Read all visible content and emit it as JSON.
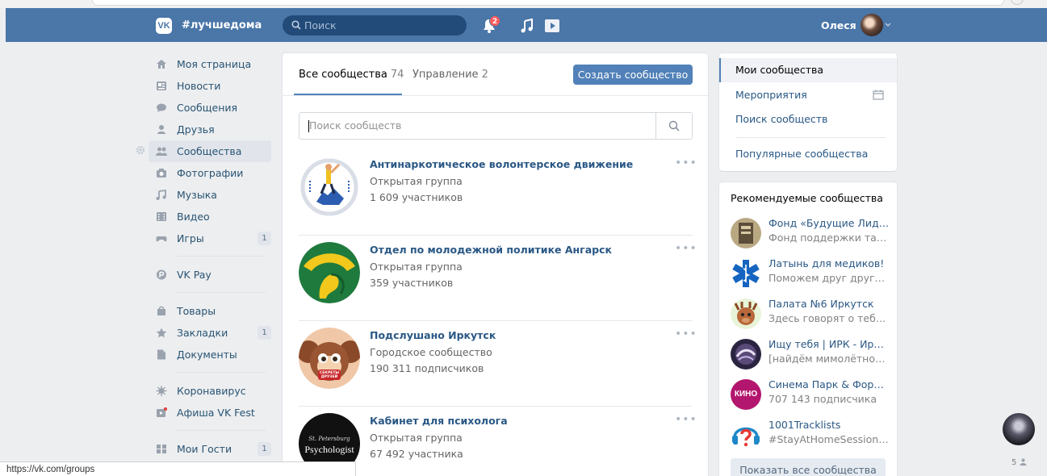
{
  "header": {
    "logo": "VK",
    "brand": "#лучшедома",
    "search_placeholder": "Поиск",
    "notif_count": "2",
    "user_name": "Олеся"
  },
  "nav": {
    "items": [
      {
        "label": "Моя страница",
        "icon": "home-icon"
      },
      {
        "label": "Новости",
        "icon": "news-icon"
      },
      {
        "label": "Сообщения",
        "icon": "messages-icon"
      },
      {
        "label": "Друзья",
        "icon": "friends-icon"
      },
      {
        "label": "Сообщества",
        "icon": "communities-icon",
        "active": true
      },
      {
        "label": "Фотографии",
        "icon": "camera-icon"
      },
      {
        "label": "Музыка",
        "icon": "music-icon"
      },
      {
        "label": "Видео",
        "icon": "video-icon"
      },
      {
        "label": "Игры",
        "icon": "gamepad-icon",
        "count": "1"
      }
    ],
    "vkpay": "VK Pay",
    "items2": [
      {
        "label": "Товары",
        "icon": "bag-icon"
      },
      {
        "label": "Закладки",
        "icon": "star-icon",
        "count": "1"
      },
      {
        "label": "Документы",
        "icon": "document-icon"
      }
    ],
    "items3": [
      {
        "label": "Коронавирус",
        "icon": "virus-icon"
      },
      {
        "label": "Афиша VK Fest",
        "icon": "poster-icon"
      }
    ],
    "guests": {
      "label": "Мои Гости",
      "count": "1"
    }
  },
  "main": {
    "tab_all_label": "Все сообщества",
    "tab_all_count": "74",
    "tab_manage_label": "Управление",
    "tab_manage_count": "2",
    "create_button": "Создать сообщество",
    "search_placeholder": "Поиск сообществ",
    "groups": [
      {
        "name": "Антинаркотическое волонтерское движение",
        "type": "Открытая группа",
        "count": "1 609 участников"
      },
      {
        "name": "Отдел по молодежной политике Ангарск",
        "type": "Открытая группа",
        "count": "359 участников"
      },
      {
        "name": "Подслушано Иркутск",
        "type": "Городское сообщество",
        "count": "190 311 подписчиков"
      },
      {
        "name": "Кабинет для психолога",
        "type": "Открытая группа",
        "count": "67 492 участника"
      }
    ],
    "group_logo_text": [
      "St. Petersburg",
      "Psychologist",
      "СЕКРЕТЫ ДРУЗЕЙ"
    ]
  },
  "right": {
    "menu": [
      "Мои сообщества",
      "Мероприятия",
      "Поиск сообществ",
      "Популярные сообщества"
    ]
  },
  "recommended": {
    "title": "Рекомендуемые сообщества",
    "items": [
      {
        "name": "Фонд «Будущие Лидеры»",
        "sub": "Фонд поддержки талантливых"
      },
      {
        "name": "Латынь для медиков!",
        "sub": "Поможем друг другу сдать"
      },
      {
        "name": "Палата №6 Иркутск",
        "sub": "Здесь говорят о тебе😸"
      },
      {
        "name": "Ищу тебя | ИРК - Иркутск",
        "sub": "[найдём мимолётное видение]"
      },
      {
        "name": "Синема Парк & Формула Кино",
        "sub": "707 143 подписчика"
      },
      {
        "name": "1001Tracklists",
        "sub": "#StayAtHomeSessions Vibes"
      }
    ],
    "show_all": "Показать все сообщества",
    "kino_logo": "КИНО"
  },
  "statusbar": {
    "url": "https://vk.com/groups"
  },
  "float": {
    "count": "5"
  },
  "colors": {
    "brand_blue": "#4a76a8",
    "link": "#2a5885",
    "button": "#5181b8"
  }
}
